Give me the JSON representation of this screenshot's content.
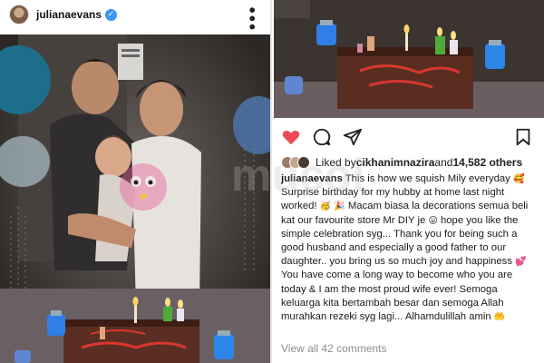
{
  "post": {
    "username": "julianaevans",
    "verified_icon": "check-badge-icon",
    "more_icon": "more-vertical-icon"
  },
  "detail": {
    "liked_by_prefix": "Liked by ",
    "liked_by_user": "cikhanimnazira",
    "liked_by_and": " and ",
    "likes_count": "14,582 others",
    "caption_user": "julianaevans",
    "caption_parts": [
      " This is how we squish Mily everyday ",
      " Surprise birthday for my hubby at home last night worked! ",
      " ",
      " Macam biasa la decorations semua beli kat our favourite store Mr DIY je ",
      " hope you like the simple celebration syg... Thank you for being such a good husband and especially a good father to our daughter.. you bring us so much joy and happiness ",
      " You have come a long way to become who you are today & I am the most proud wife ever! Semoga keluarga kita bertambah besar dan semoga Allah murahkan rezeki syg lagi... Alhamdulillah amin"
    ],
    "view_comments": "View all 42 comments"
  },
  "colors": {
    "like_red": "#ed4956",
    "verified_blue": "#3897f0",
    "muted_gray": "#8e8e8e"
  }
}
